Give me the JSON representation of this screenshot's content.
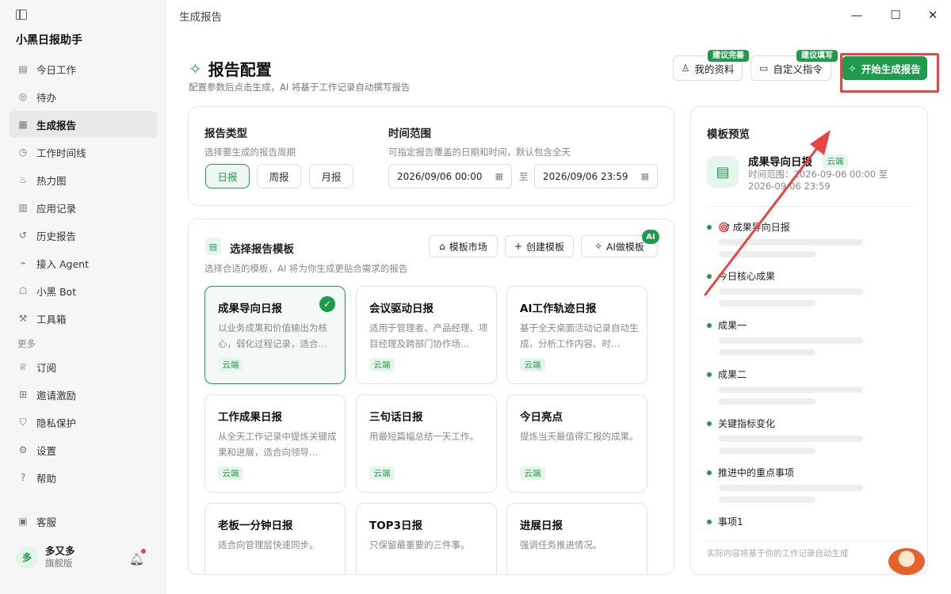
{
  "sidebar": {
    "app_name": "小黑日报助手",
    "items": [
      {
        "label": "今日工作",
        "icon": "clipboard-icon"
      },
      {
        "label": "待办",
        "icon": "check-circle-icon"
      },
      {
        "label": "生成报告",
        "icon": "document-icon",
        "active": true
      },
      {
        "label": "工作时间线",
        "icon": "clock-icon"
      },
      {
        "label": "热力图",
        "icon": "flame-icon"
      },
      {
        "label": "应用记录",
        "icon": "bar-chart-icon"
      },
      {
        "label": "历史报告",
        "icon": "history-icon"
      },
      {
        "label": "接入 Agent",
        "icon": "plug-icon"
      },
      {
        "label": "小黑 Bot",
        "icon": "bot-icon"
      },
      {
        "label": "工具箱",
        "icon": "wrench-icon"
      }
    ],
    "more_label": "更多",
    "more_items": [
      {
        "label": "订阅",
        "icon": "crown-icon"
      },
      {
        "label": "邀请激励",
        "icon": "gift-icon"
      },
      {
        "label": "隐私保护",
        "icon": "shield-icon"
      },
      {
        "label": "设置",
        "icon": "gear-icon"
      },
      {
        "label": "帮助",
        "icon": "help-icon"
      }
    ],
    "service_label": "客服",
    "user": {
      "avatar_text": "多",
      "name": "多又多",
      "plan": "旗舰版"
    }
  },
  "window": {
    "title": "生成报告"
  },
  "header": {
    "title": "报告配置",
    "subtitle": "配置参数后点击生成，AI 将基于工作记录自动撰写报告",
    "profile_button": "我的资料",
    "profile_tag": "建议完善",
    "custom_button": "自定义指令",
    "custom_tag": "建议填写",
    "generate_button": "开始生成报告"
  },
  "report_type": {
    "title": "报告类型",
    "subtitle": "选择要生成的报告周期",
    "options": [
      "日报",
      "周报",
      "月报"
    ],
    "selected": "日报"
  },
  "time_range": {
    "title": "时间范围",
    "subtitle": "可指定报告覆盖的日期和时间，默认包含全天",
    "start": "2026/09/06 00:00",
    "separator": "至",
    "end": "2026/09/06 23:59"
  },
  "templates": {
    "title": "选择报告模板",
    "subtitle": "选择合适的模板，AI 将为你生成更贴合需求的报告",
    "market_button": "模板市场",
    "create_button": "创建模板",
    "ai_button": "AI做模板",
    "ai_badge": "AI",
    "cards": [
      {
        "name": "成果导向日报",
        "desc": "以业务成果和价值输出为核心，弱化过程记录，适合…",
        "tag": "云端",
        "selected": true
      },
      {
        "name": "会议驱动日报",
        "desc": "适用于管理者、产品经理、项目经理及跨部门协作场…",
        "tag": "云端"
      },
      {
        "name": "AI工作轨迹日报",
        "desc": "基于全天桌面活动记录自动生成，分析工作内容、时…",
        "tag": "云端"
      },
      {
        "name": "工作成果日报",
        "desc": "从全天工作记录中提炼关键成果和进展，适合向领导…",
        "tag": "云端"
      },
      {
        "name": "三句话日报",
        "desc": "用最短篇幅总结一天工作。",
        "tag": "云端"
      },
      {
        "name": "今日亮点",
        "desc": "提炼当天最值得汇报的成果。",
        "tag": "云端"
      },
      {
        "name": "老板一分钟日报",
        "desc": "适合向管理层快速同步。",
        "tag": ""
      },
      {
        "name": "TOP3日报",
        "desc": "只保留最重要的三件事。",
        "tag": ""
      },
      {
        "name": "进展日报",
        "desc": "强调任务推进情况。",
        "tag": ""
      }
    ]
  },
  "preview": {
    "title": "模板预览",
    "template_name": "成果导向日报",
    "template_tag": "云端",
    "time_label": "时间范围：2026-09-06 00:00 至 2026-09-06 23:59",
    "sections": [
      "🎯 成果导向日报",
      "今日核心成果",
      "成果一",
      "成果二",
      "关键指标变化",
      "推进中的重点事项",
      "事项1"
    ],
    "footer": "实际内容将基于你的工作记录自动生成"
  },
  "colors": {
    "accent": "#1f9b4c",
    "annotation": "#e84545"
  }
}
